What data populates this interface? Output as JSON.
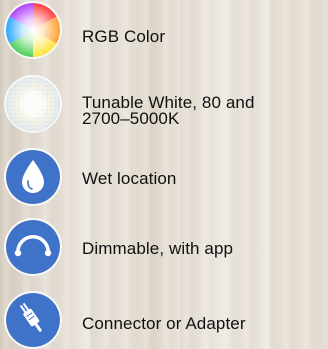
{
  "features": [
    {
      "icon": "rgb-color-wheel-icon",
      "label": "RGB Color"
    },
    {
      "icon": "tunable-white-icon",
      "label_line1": "Tunable White, 80 and",
      "label_line2": "2700–5000K"
    },
    {
      "icon": "water-drop-icon",
      "label": "Wet location"
    },
    {
      "icon": "dimmer-arc-icon",
      "label": "Dimmable, with app"
    },
    {
      "icon": "connector-plug-icon",
      "label": "Connector or Adapter"
    }
  ],
  "colors": {
    "icon_blue": "#3f73c9",
    "text": "#111111"
  }
}
